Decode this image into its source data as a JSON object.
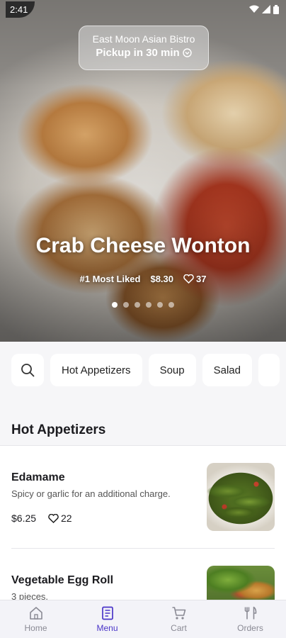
{
  "status_bar": {
    "time": "2:41"
  },
  "hero": {
    "store_name": "East Moon Asian Bistro",
    "pickup_label": "Pickup in 30 min",
    "title": "Crab Cheese Wonton",
    "rank": "#1 Most Liked",
    "price": "$8.30",
    "likes": "37",
    "carousel_dots": 6,
    "active_dot": 1
  },
  "categories": {
    "chips": [
      "Hot Appetizers",
      "Soup",
      "Salad",
      ""
    ]
  },
  "section": {
    "title": "Hot Appetizers"
  },
  "menu_items": [
    {
      "name": "Edamame",
      "description": "Spicy or garlic for an additional charge.",
      "price": "$6.25",
      "likes": "22",
      "image_icon": "edamame-photo"
    },
    {
      "name": "Vegetable Egg Roll",
      "description": "3 pieces.",
      "price": "",
      "likes": "",
      "image_icon": "egg-roll-photo"
    }
  ],
  "bottom_nav": {
    "active": "Menu",
    "items": [
      {
        "label": "Home",
        "icon": "home-icon"
      },
      {
        "label": "Menu",
        "icon": "menu-book-icon"
      },
      {
        "label": "Cart",
        "icon": "cart-icon"
      },
      {
        "label": "Orders",
        "icon": "orders-icon"
      }
    ]
  },
  "colors": {
    "accent": "#4a35c8",
    "inactive_nav": "#8a8a94",
    "background_gray": "#f6f6f8"
  }
}
